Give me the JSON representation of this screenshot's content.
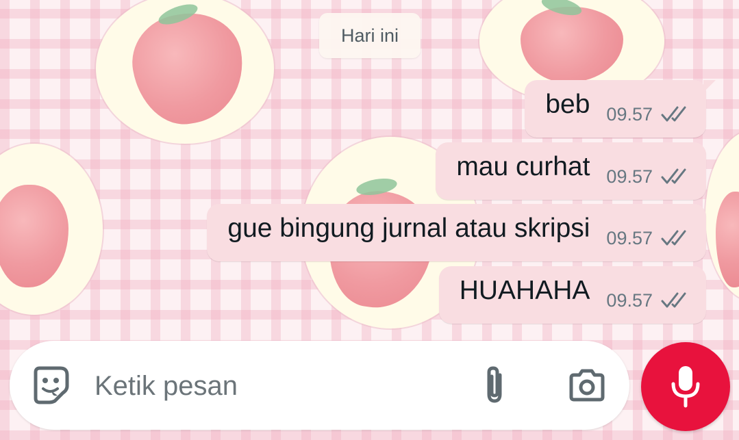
{
  "chat": {
    "date_chip": "Hari ini",
    "messages": [
      {
        "text": "beb",
        "time": "09.57",
        "status": "read"
      },
      {
        "text": "mau curhat",
        "time": "09.57",
        "status": "read"
      },
      {
        "text": "gue bingung jurnal atau skripsi",
        "time": "09.57",
        "status": "read"
      },
      {
        "text": "HUAHAHA",
        "time": "09.57",
        "status": "read"
      }
    ]
  },
  "composer": {
    "placeholder": "Ketik pesan",
    "value": "",
    "icons": {
      "sticker": "sticker-icon",
      "attach": "paperclip-icon",
      "camera": "camera-icon",
      "mic": "microphone-icon"
    }
  },
  "colors": {
    "outgoing_bubble": "#f9dde1",
    "mic_button": "#e8123d",
    "tick_color": "#667781"
  }
}
